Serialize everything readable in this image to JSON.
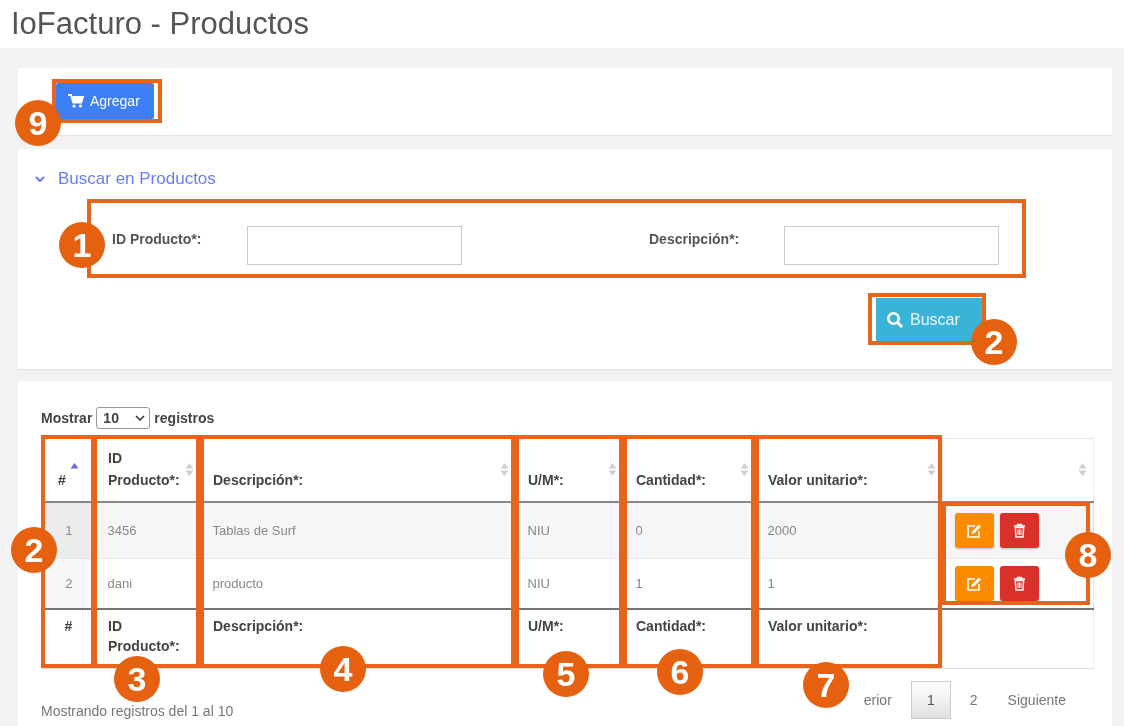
{
  "title": "IoFacturo - Productos",
  "toolbar": {
    "add_button": "Agregar"
  },
  "search": {
    "title": "Buscar en Productos",
    "expanded": true,
    "fields": [
      {
        "label": "ID Producto*:"
      },
      {
        "label": "Descripción*:"
      }
    ],
    "button": "Buscar"
  },
  "table": {
    "length_before": "Mostrar",
    "length_value": "10",
    "length_after": "registros",
    "columns": [
      {
        "label": "#",
        "sorted": true
      },
      {
        "label": "ID Producto*:",
        "sorted": false
      },
      {
        "label": "Descripción*:",
        "sorted": false
      },
      {
        "label": "U/M*:",
        "sorted": false
      },
      {
        "label": "Cantidad*:",
        "sorted": false
      },
      {
        "label": "Valor unitario*:",
        "sorted": false
      }
    ],
    "rows": [
      {
        "cells": [
          "1",
          "3456",
          "Tablas de Surf",
          "NIU",
          "0",
          "2000"
        ]
      },
      {
        "cells": [
          "2",
          "dani",
          "producto",
          "NIU",
          "1",
          "1"
        ]
      }
    ],
    "footer": [
      "#",
      "ID Producto*:",
      "Descripción*:",
      "U/M*:",
      "Cantidad*:",
      "Valor unitario*:"
    ],
    "info": "Mostrando registros del 1 al 10",
    "pagination": [
      {
        "label": "erior",
        "selected": false
      },
      {
        "label": "1",
        "selected": true
      },
      {
        "label": "2",
        "selected": false
      },
      {
        "label": "Siguiente",
        "selected": false
      }
    ]
  },
  "annotations": [
    {
      "label": "9"
    },
    {
      "label": "1"
    },
    {
      "label": "2"
    },
    {
      "label": "2"
    },
    {
      "label": "3"
    },
    {
      "label": "4"
    },
    {
      "label": "5"
    },
    {
      "label": "6"
    },
    {
      "label": "7"
    },
    {
      "label": "8"
    }
  ]
}
